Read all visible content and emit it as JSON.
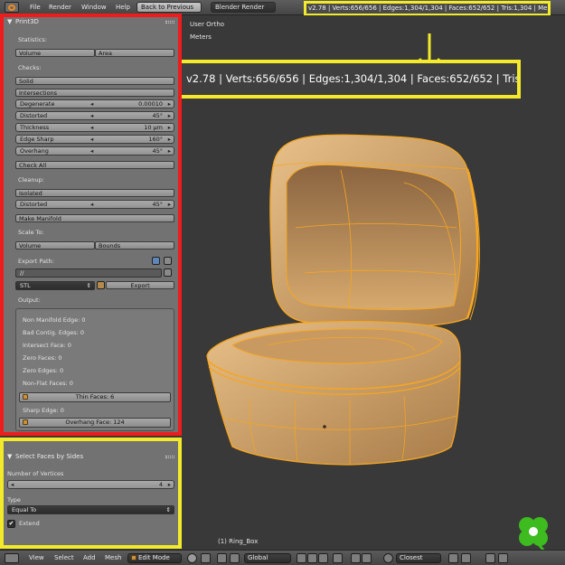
{
  "top_bar": {
    "menu": [
      "File",
      "Render",
      "Window",
      "Help"
    ],
    "back_button": "Back to Previous",
    "render_engine": "Blender Render",
    "stats": "v2.78 | Verts:656/656 | Edges:1,304/1,304 | Faces:652/652 | Tris:1,304 | Mem:91.9"
  },
  "viewport": {
    "view_name": "User Ortho",
    "units": "Meters",
    "stats_callout": "v2.78 | Verts:656/656 | Edges:1,304/1,304 | Faces:652/652 | Tris:1,304",
    "object_label": "(1) Ring_Box"
  },
  "print3d": {
    "title": "Print3D",
    "statistics_label": "Statistics:",
    "volume_button": "Volume",
    "area_button": "Area",
    "checks_label": "Checks:",
    "solid_button": "Solid",
    "intersections_button": "Intersections",
    "degenerate": {
      "label": "Degenerate",
      "value": "0.00010"
    },
    "distorted": {
      "label": "Distorted",
      "value": "45°"
    },
    "thickness": {
      "label": "Thickness",
      "value": "10 µm"
    },
    "edge_sharp": {
      "label": "Edge Sharp",
      "value": "160°"
    },
    "overhang": {
      "label": "Overhang",
      "value": "45°"
    },
    "check_all_button": "Check All",
    "cleanup_label": "Cleanup:",
    "isolated_button": "Isolated",
    "cleanup_distorted": {
      "label": "Distorted",
      "value": "45°"
    },
    "make_manifold_button": "Make Manifold",
    "scale_to_label": "Scale To:",
    "scale_volume_button": "Volume",
    "bounds_button": "Bounds",
    "export_path_label": "Export Path:",
    "export_path_value": "//",
    "format_value": "STL",
    "export_button": "Export",
    "output_label": "Output:",
    "output": {
      "non_manifold": "Non Manifold Edge: 0",
      "bad_contig": "Bad Contig. Edges: 0",
      "intersect": "Intersect Face: 0",
      "zero_faces": "Zero Faces: 0",
      "zero_edges": "Zero Edges: 0",
      "non_flat": "Non-Flat Faces: 0",
      "thin_faces": "Thin Faces: 6",
      "sharp_edge": "Sharp Edge: 0",
      "overhang_face": "Overhang Face: 124"
    }
  },
  "operator": {
    "title": "Select Faces by Sides",
    "num_vertices_label": "Number of Vertices",
    "num_vertices_value": "4",
    "type_label": "Type",
    "type_value": "Equal To",
    "extend_label": "Extend",
    "extend_checked": true
  },
  "bottom_bar": {
    "menu": [
      "View",
      "Select",
      "Add",
      "Mesh"
    ],
    "mode": "Edit Mode",
    "orientation": "Global",
    "proportional": "Closest"
  },
  "colors": {
    "highlight_red": "#ee1c1c",
    "highlight_yellow": "#f2ea2a",
    "mesh_orange": "#f5a623",
    "blender_orange": "#f08a1f"
  }
}
